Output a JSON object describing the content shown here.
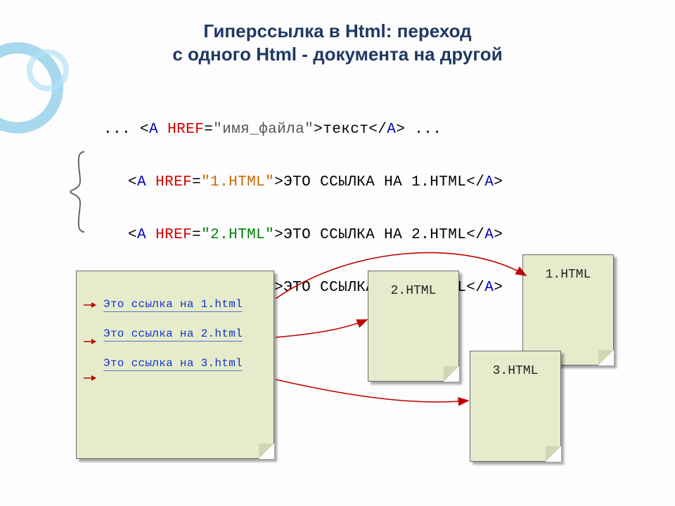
{
  "title": {
    "line1": "Гиперссылка  в Html:  переход",
    "line2": "с одного Html - документа на другой"
  },
  "syntax": {
    "prefix": "...",
    "tag_open_a": "A",
    "href_kw": "HREF",
    "eq": "=",
    "q": "\"",
    "fname": "имя_файла",
    "gt": ">",
    "linktext": "текст",
    "tag_close_a": "A",
    "suffix": "..."
  },
  "examples": [
    {
      "file": "1.HTML",
      "text": "Это ссылка на 1.HTML",
      "cls": "str-1"
    },
    {
      "file": "2.HTML",
      "text": "Это ссылка на 2.HTML",
      "cls": "str-2"
    },
    {
      "file": "3.HTML",
      "text": "Это ссылка на 3.HTML",
      "cls": "str-3"
    }
  ],
  "main_doc_links": [
    "Это ссылка на 1.html",
    "Это ссылка на 2.html",
    "Это ссылка на 3.html"
  ],
  "small_docs": {
    "d1": "1.HTML",
    "d2": "2.HTML",
    "d3": "3.HTML"
  }
}
